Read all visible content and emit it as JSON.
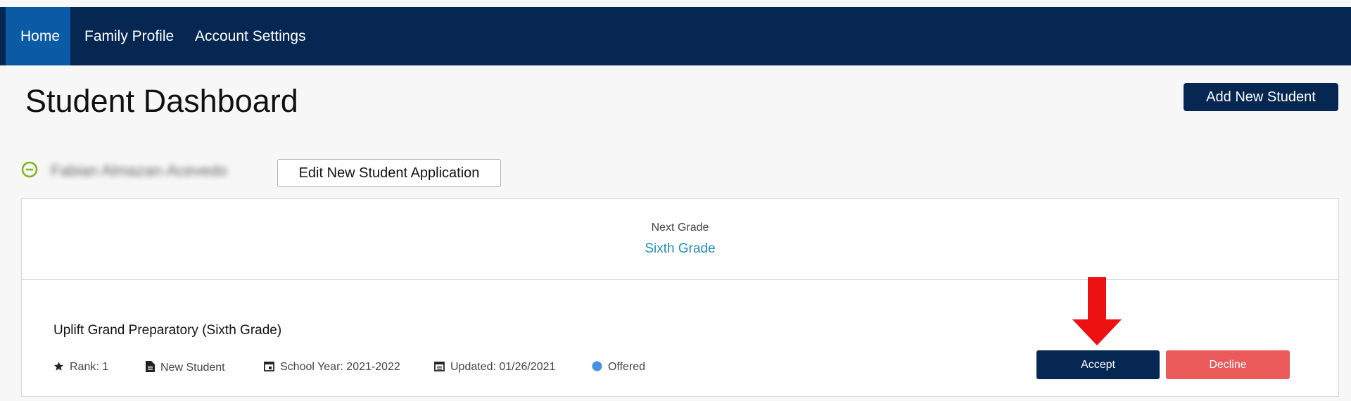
{
  "nav": {
    "items": [
      {
        "label": "Home"
      },
      {
        "label": "Family Profile"
      },
      {
        "label": "Account Settings"
      }
    ]
  },
  "page": {
    "title": "Student Dashboard",
    "add_button": "Add New Student"
  },
  "student": {
    "name": "Fabian Almazan-Acevedo",
    "edit_button": "Edit New Student Application",
    "next_grade_label": "Next Grade",
    "next_grade_value": "Sixth Grade",
    "application": {
      "school": "Uplift Grand Preparatory (Sixth Grade)",
      "rank": "Rank: 1",
      "type": "New Student",
      "school_year": "School Year: 2021-2022",
      "updated": "Updated: 01/26/2021",
      "status": "Offered",
      "accept": "Accept",
      "decline": "Decline"
    }
  },
  "colors": {
    "nav_bg": "#052752",
    "nav_active": "#0a5aa6",
    "accept": "#052752",
    "decline": "#ea5a5a",
    "status_dot": "#4a90e2",
    "grade_value": "#1f8fbf",
    "arrow": "#ee1111"
  },
  "icons": {
    "collapse": "minus-circle-icon",
    "rank": "star-icon",
    "type": "document-icon",
    "school_year": "calendar-icon",
    "updated": "calendar-icon",
    "status": "dot-icon",
    "annotation": "down-arrow-icon"
  }
}
